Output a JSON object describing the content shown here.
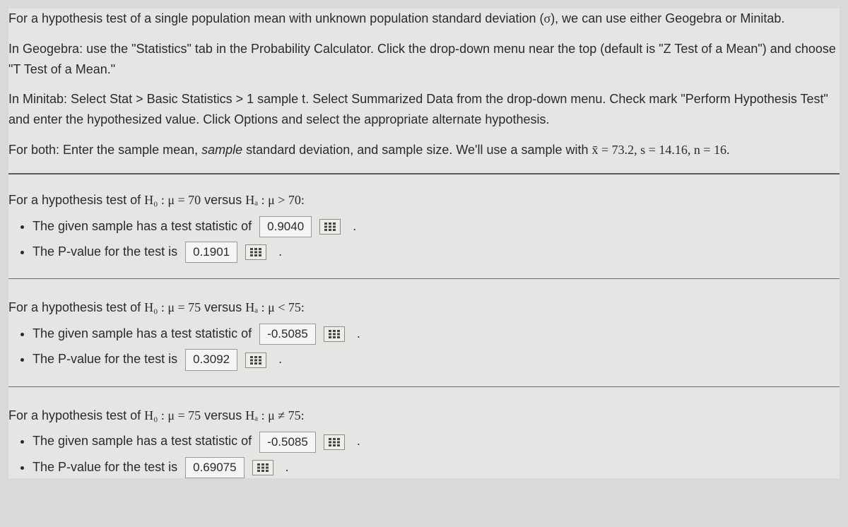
{
  "intro": {
    "p1_a": "For a hypothesis test of a single population mean with unknown population standard deviation (",
    "p1_sigma": "σ",
    "p1_b": "), we can use either Geogebra or Minitab.",
    "p2": "In Geogebra: use the \"Statistics\" tab in the Probability Calculator. Click the drop-down menu near the top (default is \"Z Test of a Mean\") and choose \"T Test of a Mean.\"",
    "p3": "In Minitab: Select Stat > Basic Statistics > 1 sample t. Select Summarized Data from the drop-down menu. Check mark \"Perform Hypothesis Test\" and enter the hypothesized value. Click Options and select the appropriate alternate hypothesis.",
    "p4_a": "For both: Enter the sample mean, ",
    "p4_sample": "sample",
    "p4_b": " standard deviation, and sample size. We'll use a sample with ",
    "p4_stats": "x̄ = 73.2, s = 14.16, n = 16."
  },
  "q1": {
    "prompt_a": "For a hypothesis test of ",
    "prompt_h0": "H₀ : μ = 70",
    "prompt_b": " versus ",
    "prompt_ha": "Hₐ : μ > 70:",
    "li1": "The given sample has a test statistic of",
    "val1": "0.9040",
    "li2": "The P-value for the test is",
    "val2": "0.1901"
  },
  "q2": {
    "prompt_a": "For a hypothesis test of ",
    "prompt_h0": "H₀ : μ = 75",
    "prompt_b": " versus ",
    "prompt_ha": "Hₐ : μ < 75:",
    "li1": "The given sample has a test statistic of",
    "val1": "-0.5085",
    "li2": "The P-value for the test is",
    "val2": "0.3092"
  },
  "q3": {
    "prompt_a": "For a hypothesis test of ",
    "prompt_h0": "H₀ : μ = 75",
    "prompt_b": " versus ",
    "prompt_ha": "Hₐ : μ ≠ 75:",
    "li1": "The given sample has a test statistic of",
    "val1": "-0.5085",
    "li2": "The P-value for the test is",
    "val2": "0.69075"
  }
}
